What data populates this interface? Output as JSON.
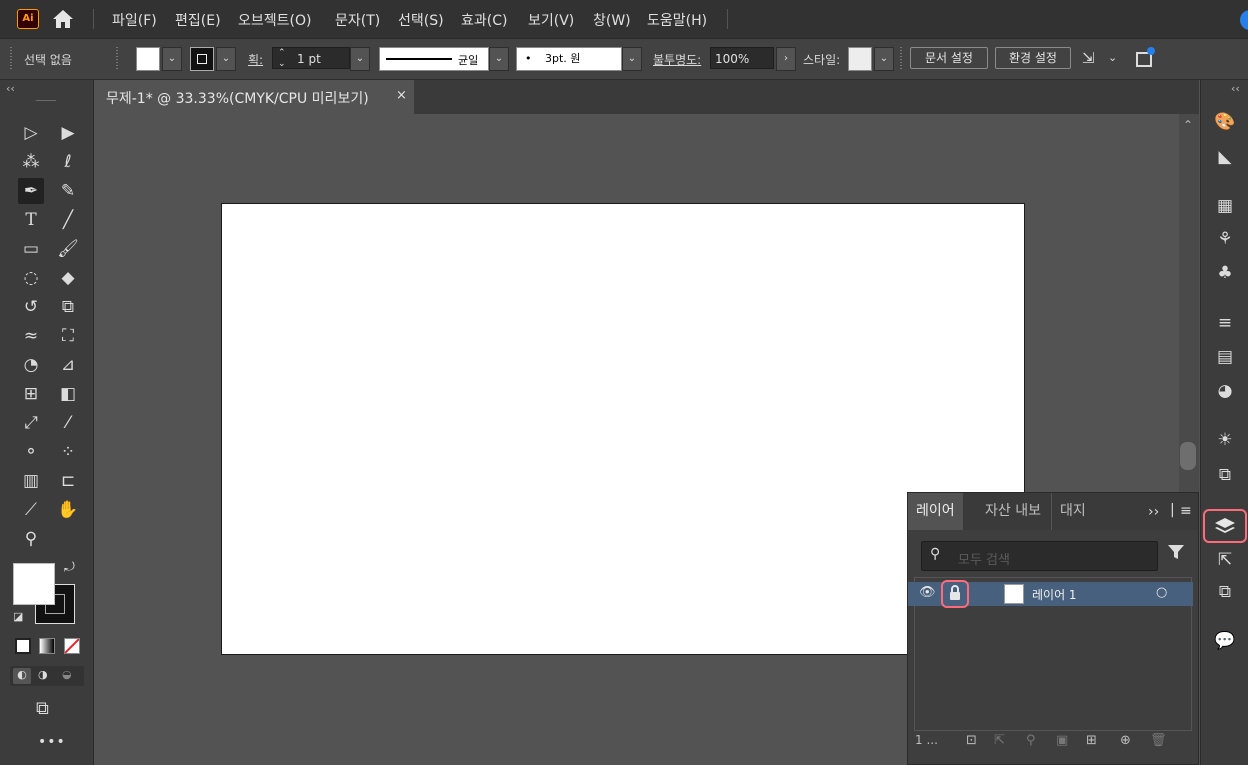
{
  "app": {
    "logo": "Ai",
    "home_icon": "home-icon"
  },
  "menu": [
    "파일(F)",
    "편집(E)",
    "오브젝트(O)",
    "문자(T)",
    "선택(S)",
    "효과(C)",
    "보기(V)",
    "창(W)",
    "도움말(H)"
  ],
  "control": {
    "selection": "선택 없음",
    "stroke_label": "획:",
    "stroke_weight": "1 pt",
    "stroke_profile": "균일",
    "brush": "3pt. 원",
    "opacity_label": "불투명도:",
    "opacity": "100%",
    "style_label": "스타일:",
    "doc_setup": "문서 설정",
    "preferences": "환경 설정"
  },
  "document": {
    "tab_title": "무제-1* @ 33.33%(CMYK/CPU 미리보기)",
    "close": "×"
  },
  "layers_panel": {
    "tabs": [
      "레이어",
      "자산 내보",
      "대지"
    ],
    "expand": "››",
    "search_placeholder": "모두 검색",
    "layers": [
      {
        "name": "레이어 1",
        "visible": true,
        "locked": true,
        "target": "○"
      }
    ],
    "count": "1 ..."
  },
  "colors": {
    "highlight": "#ff6b7a",
    "selected_layer": "#46607d",
    "accent": "#2680eb"
  }
}
